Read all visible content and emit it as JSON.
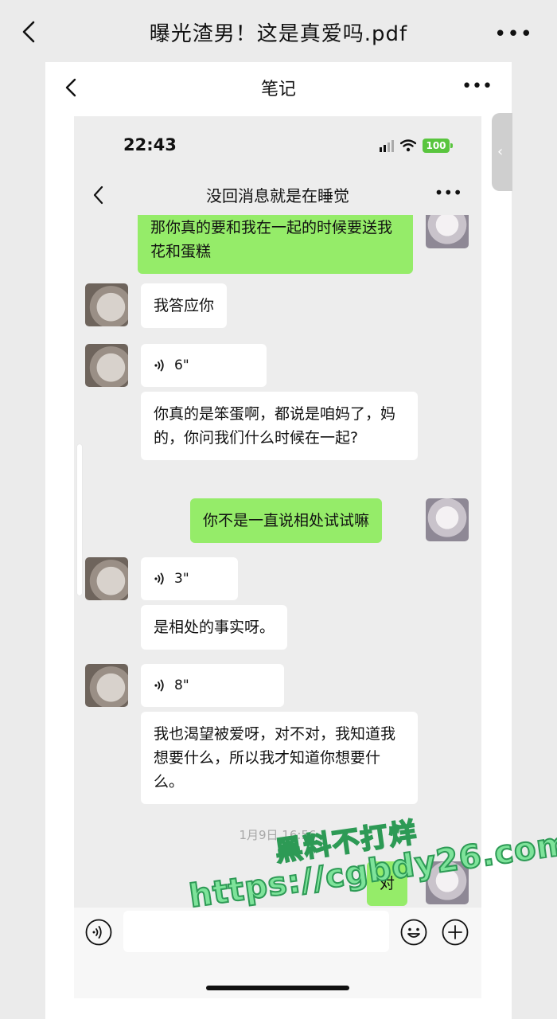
{
  "viewer": {
    "title": "曝光渣男！这是真爱吗.pdf",
    "more": "•••"
  },
  "note": {
    "title": "笔记",
    "more": "•••",
    "side_tab": "‹"
  },
  "phone": {
    "time": "22:43",
    "battery": "100",
    "chat_title": "没回消息就是在睡觉",
    "chat_more": "•••"
  },
  "messages": {
    "m1": "那你真的要和我在一起的时候要送我花和蛋糕",
    "m2": "我答应你",
    "m3_voice": "6\"",
    "m4": "你真的是笨蛋啊，都说是咱妈了，妈的，你问我们什么时候在一起?",
    "m5": "你不是一直说相处试试嘛",
    "m6_voice": "3\"",
    "m7": "是相处的事实呀。",
    "m8_voice": "8\"",
    "m9": "我也渴望被爱呀，对不对，我知道我想要什么，所以我才知道你想要什么。",
    "timestamp": "1月9日 16:56",
    "m10": "对"
  },
  "watermark": {
    "line1": "黑料不打烊",
    "line2": "https://cgbdy26.com"
  },
  "icons": {
    "back": "chevron-left-icon",
    "more": "more-icon",
    "voice": "voice-icon",
    "emoji": "emoji-icon",
    "plus": "plus-icon",
    "wifi": "wifi-icon",
    "signal": "signal-icon",
    "battery": "battery-icon"
  },
  "colors": {
    "sent_bubble": "#95ec69",
    "received_bubble": "#ffffff",
    "chat_background": "#ededed",
    "battery": "#59c53e"
  }
}
